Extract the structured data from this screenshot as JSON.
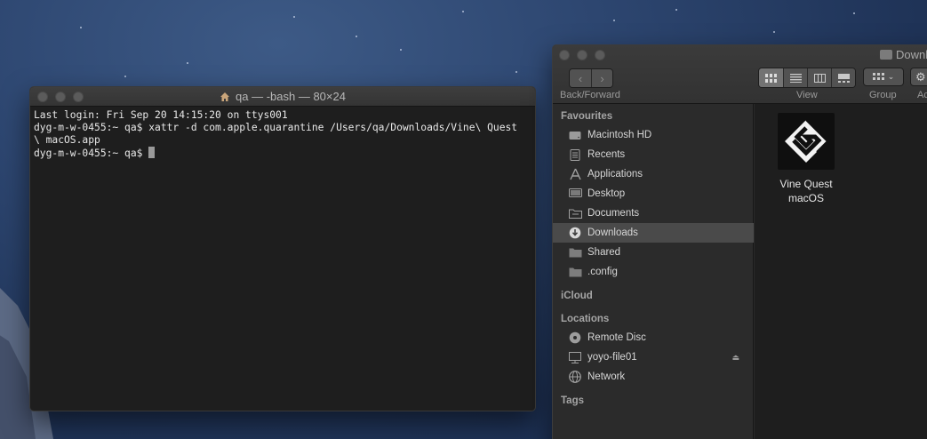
{
  "terminal": {
    "title": "qa — -bash — 80×24",
    "lines": [
      "Last login: Fri Sep 20 14:15:20 on ttys001",
      "dyg-m-w-0455:~ qa$ xattr -d com.apple.quarantine /Users/qa/Downloads/Vine\\ Quest",
      "\\ macOS.app",
      "dyg-m-w-0455:~ qa$ "
    ]
  },
  "finder": {
    "title": "Downloads",
    "toolbar": {
      "back_label": "‹",
      "forward_label": "›",
      "backforward_label": "Back/Forward",
      "view_label": "View",
      "group_label": "Group",
      "action_label": "Ac"
    },
    "sidebar": {
      "favourites_header": "Favourites",
      "favourites": [
        {
          "label": "Macintosh HD",
          "icon": "hard-drive-icon"
        },
        {
          "label": "Recents",
          "icon": "recents-icon"
        },
        {
          "label": "Applications",
          "icon": "applications-icon"
        },
        {
          "label": "Desktop",
          "icon": "desktop-icon"
        },
        {
          "label": "Documents",
          "icon": "documents-icon"
        },
        {
          "label": "Downloads",
          "icon": "downloads-icon",
          "selected": true
        },
        {
          "label": "Shared",
          "icon": "folder-icon"
        },
        {
          "label": ".config",
          "icon": "folder-icon"
        }
      ],
      "icloud_header": "iCloud",
      "locations_header": "Locations",
      "locations": [
        {
          "label": "Remote Disc",
          "icon": "disc-icon"
        },
        {
          "label": "yoyo-file01",
          "icon": "server-icon"
        },
        {
          "label": "Network",
          "icon": "network-icon"
        }
      ],
      "tags_header": "Tags"
    },
    "content": {
      "items": [
        {
          "name_line1": "Vine Quest",
          "name_line2": "macOS",
          "icon": "game-maker-app-icon"
        }
      ]
    }
  },
  "colors": {
    "wallpaper": "#24395f",
    "terminal_bg": "#1e1e1e",
    "sidebar_selected": "#4a4a4a"
  }
}
